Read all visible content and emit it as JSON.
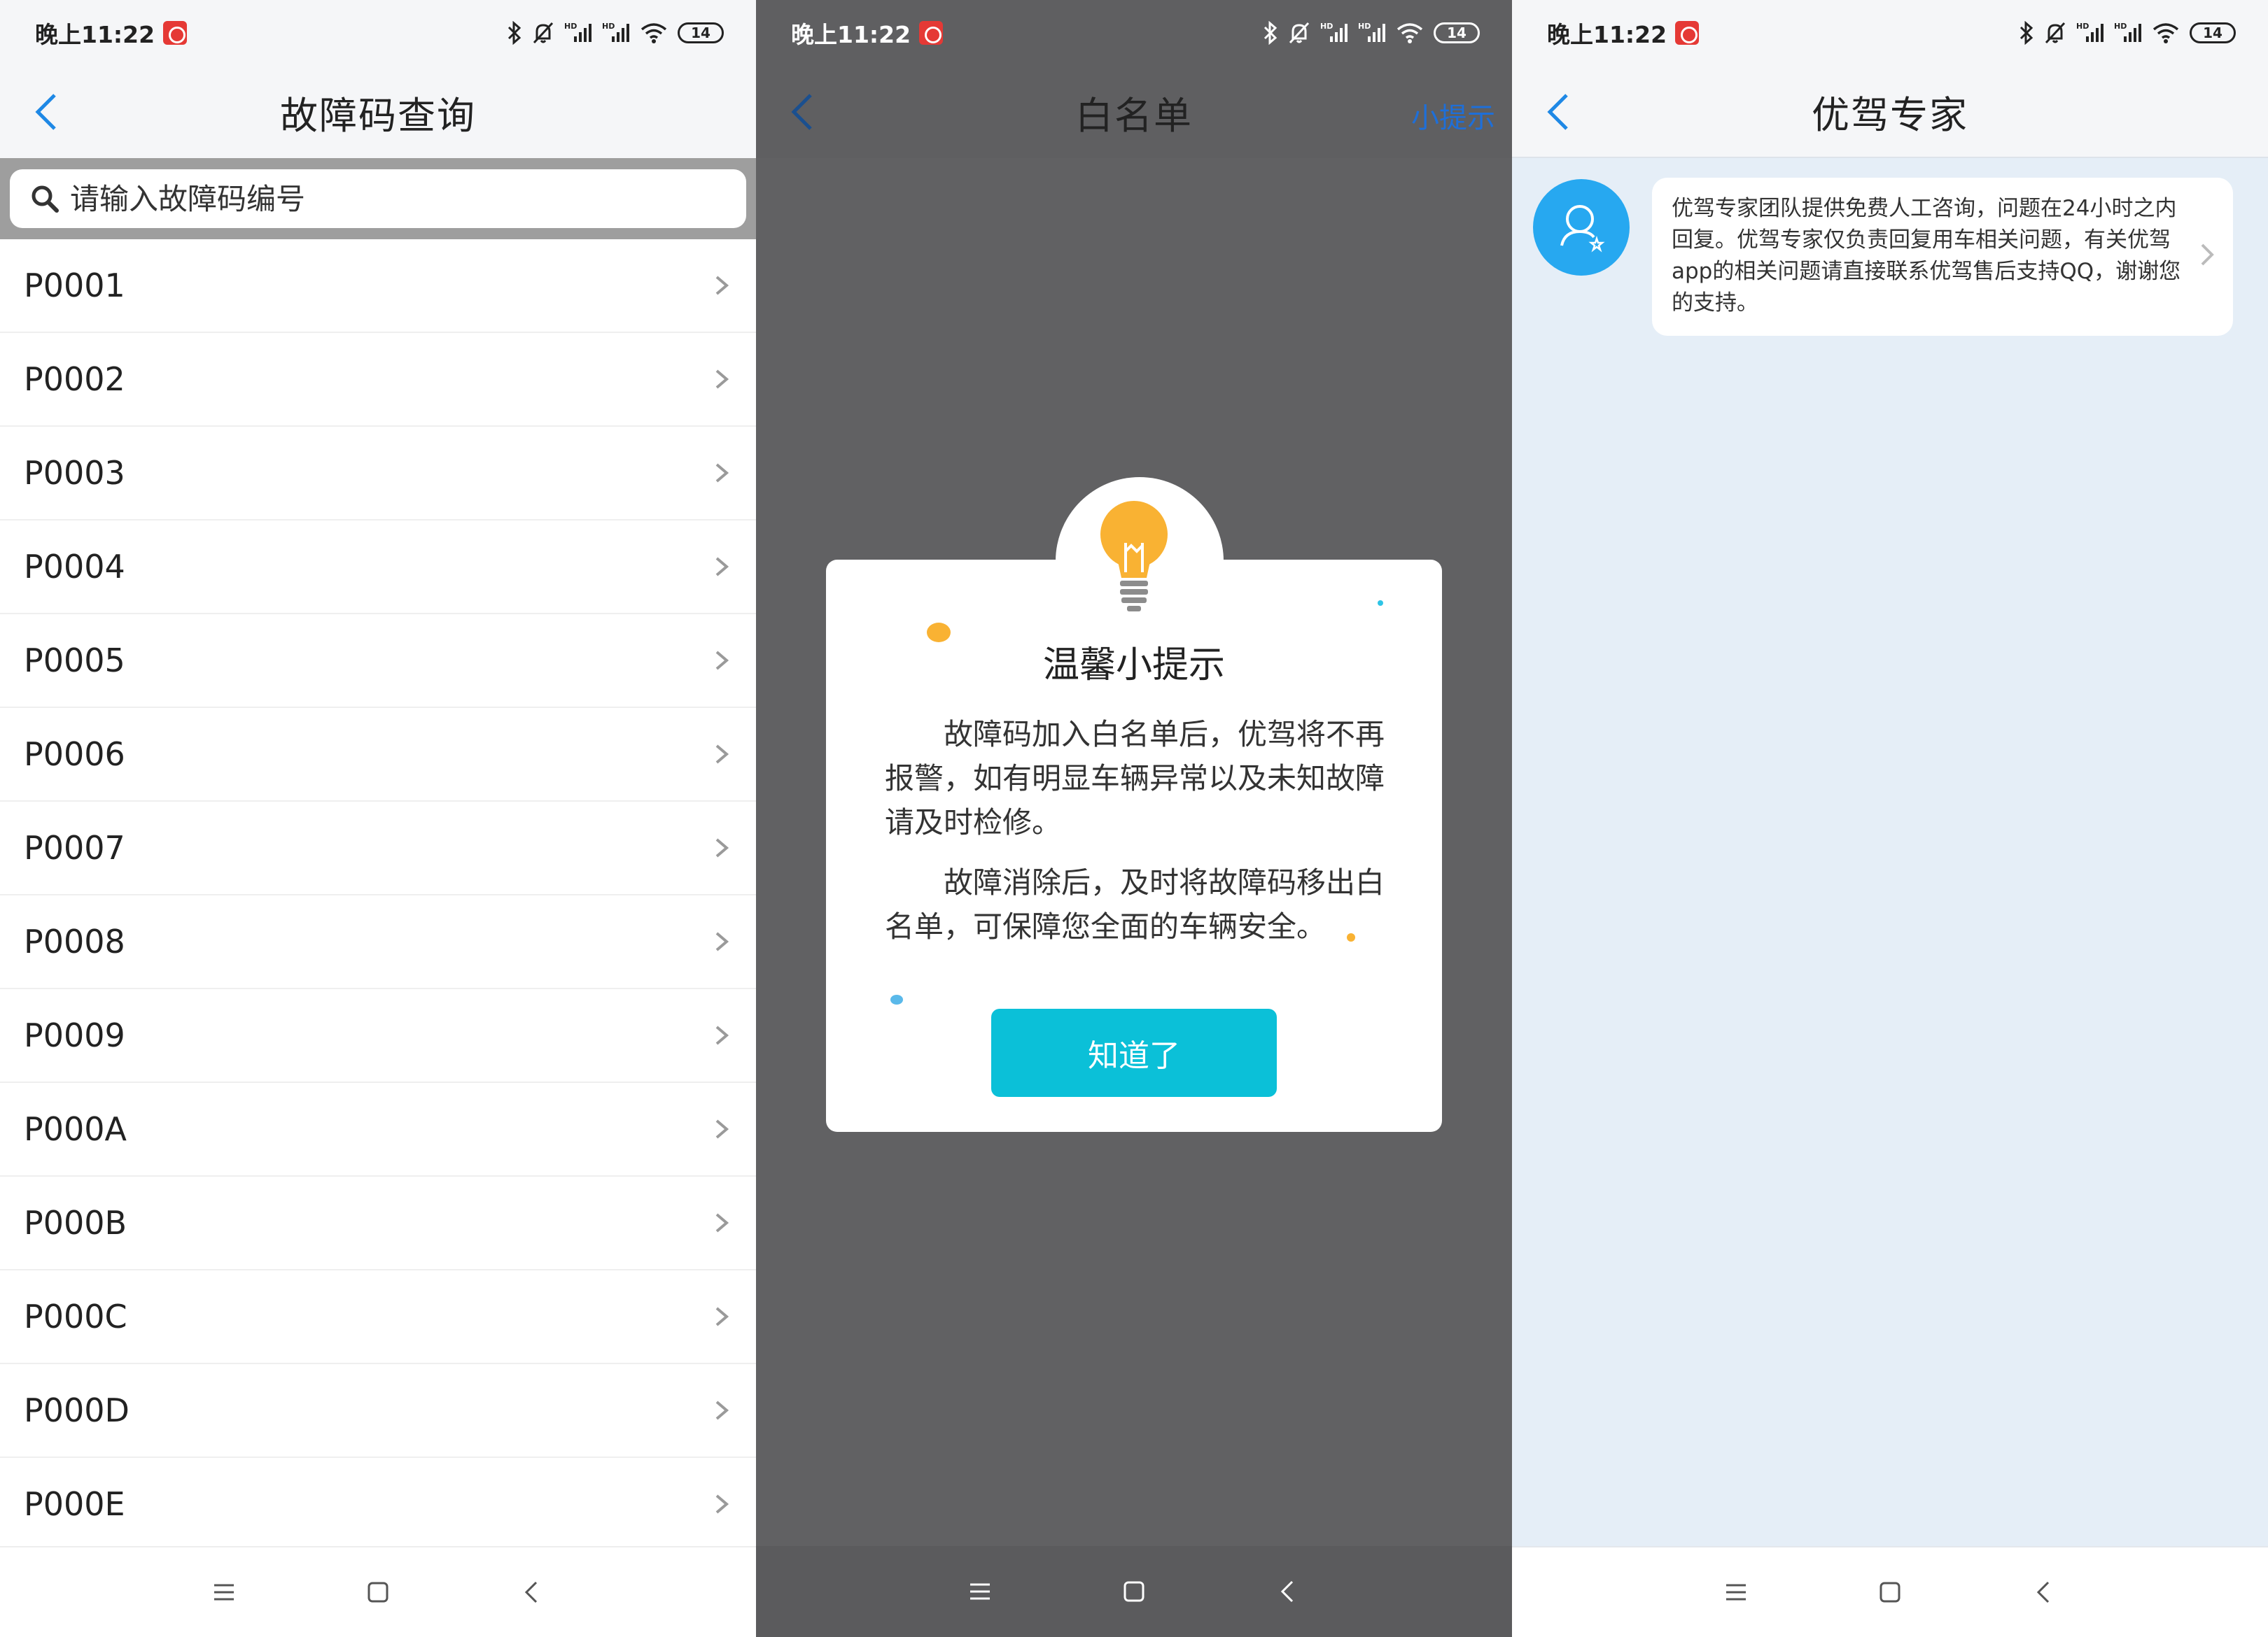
{
  "status_bar": {
    "time": "晚上11:22",
    "battery": "14"
  },
  "screen1": {
    "title": "故障码查询",
    "search_placeholder": "请输入故障码编号",
    "codes": [
      "P0001",
      "P0002",
      "P0003",
      "P0004",
      "P0005",
      "P0006",
      "P0007",
      "P0008",
      "P0009",
      "P000A",
      "P000B",
      "P000C",
      "P000D",
      "P000E"
    ]
  },
  "screen2": {
    "title": "白名单",
    "hint_link": "小提示",
    "dialog": {
      "title": "温馨小提示",
      "paragraph1": "故障码加入白名单后，优驾将不再报警，如有明显车辆异常以及未知故障请及时检修。",
      "paragraph2": "故障消除后，及时将故障码移出白名单，可保障您全面的车辆安全。",
      "button": "知道了"
    }
  },
  "screen3": {
    "title": "优驾专家",
    "message": "优驾专家团队提供免费人工咨询，问题在24小时之内回复。优驾专家仅负责回复用车相关问题，有关优驾app的相关问题请直接联系优驾售后支持QQ，谢谢您的支持。"
  },
  "colors": {
    "accent_blue": "#1e6fd9",
    "button_cyan": "#0bc0d8",
    "avatar_blue": "#27a8f0",
    "bulb_yellow": "#f9b233",
    "overlay_gray": "#616163"
  },
  "icons": {
    "back": "chevron-left-icon",
    "search": "search-icon",
    "row_arrow": "chevron-right-icon",
    "bulb": "lightbulb-icon",
    "avatar": "expert-avatar-icon",
    "nav": [
      "menu-icon",
      "home-icon",
      "back-nav-icon"
    ]
  }
}
